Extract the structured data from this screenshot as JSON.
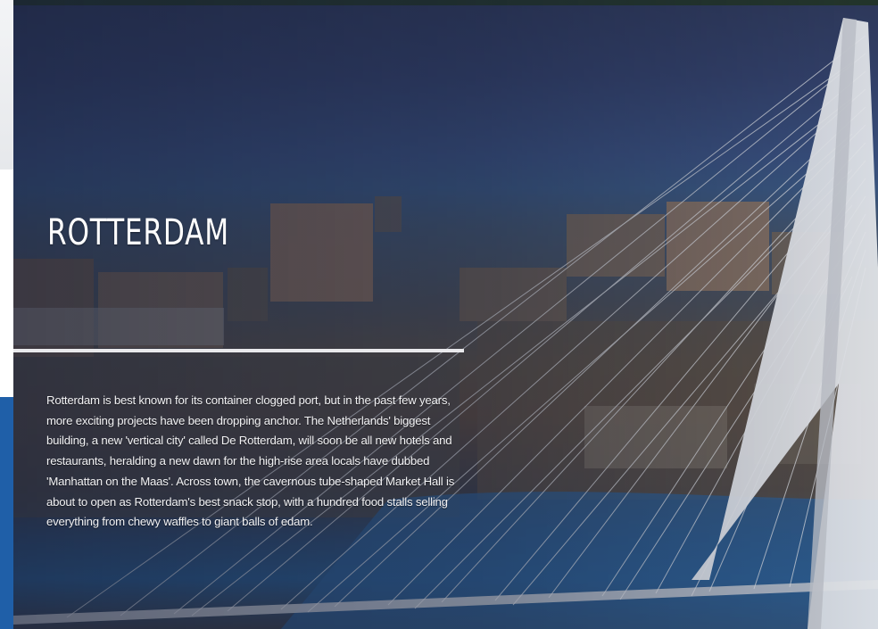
{
  "article": {
    "title": "ROTTERDAM",
    "body": "Rotterdam is best known for its container clogged port, but in the past few years, more exciting projects have been dropping anchor. The Netherlands' biggest building, a new 'vertical city' called De Rotterdam, will soon be all new hotels and restaurants, heralding a new dawn for the high-rise area locals have dubbed 'Manhattan on the Maas'. Across town, the cavernous tube-shaped Market Hall is about to open as Rotterdam's best snack stop, with a hundred food stalls selling everything from chewy waffles to giant balls of edam."
  },
  "colors": {
    "page_edge_blue": "#1f5fa8",
    "overlay_navy": "#161e38",
    "title_text": "#ffffff",
    "divider": "#e9e9ec"
  }
}
